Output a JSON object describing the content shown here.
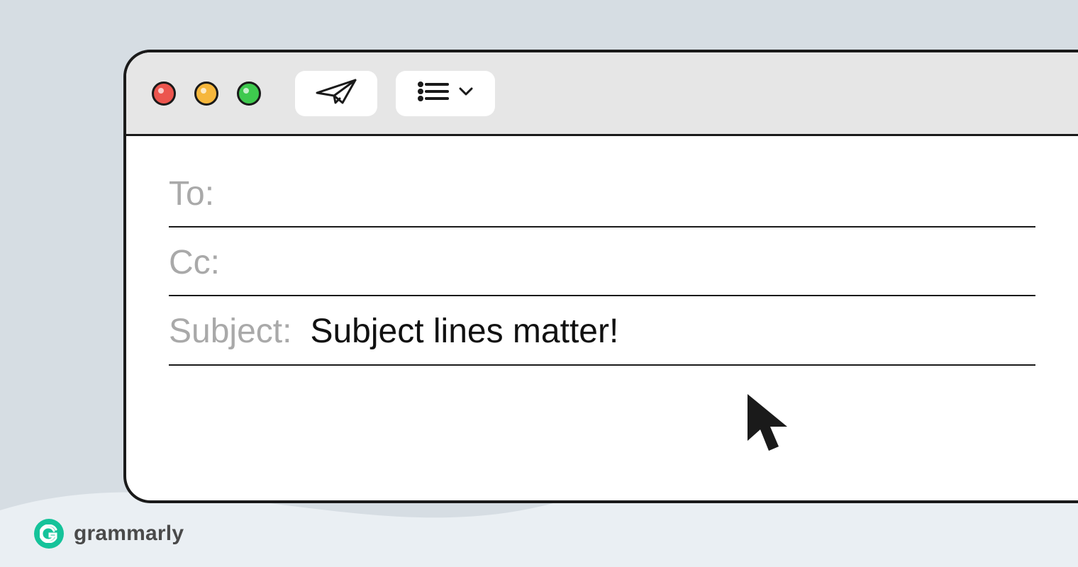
{
  "window": {
    "traffic_lights": [
      "close",
      "minimize",
      "zoom"
    ],
    "toolbar": {
      "send_icon": "paper-plane",
      "format_icon": "list-lines",
      "format_has_chevron": true
    }
  },
  "fields": {
    "to": {
      "label": "To:",
      "value": ""
    },
    "cc": {
      "label": "Cc:",
      "value": ""
    },
    "subject": {
      "label": "Subject:",
      "value": "Subject lines matter!"
    }
  },
  "brand": {
    "name": "grammarly",
    "mark_letter": "G",
    "mark_color": "#15c39a"
  },
  "colors": {
    "page_bg": "#d6dde3",
    "wave": "#eaeff3",
    "titlebar": "#e6e6e6",
    "stroke": "#1a1a1a",
    "label": "#a9a9a9"
  }
}
